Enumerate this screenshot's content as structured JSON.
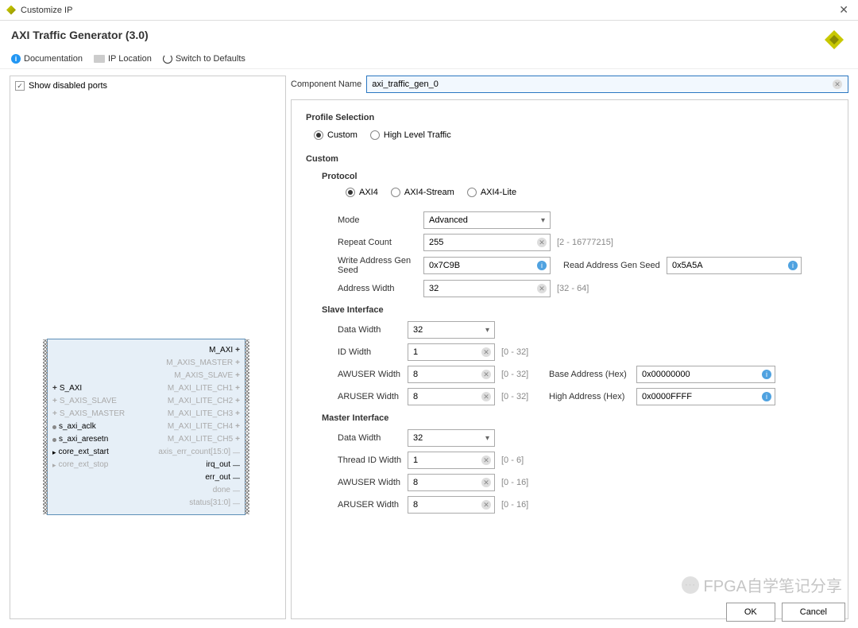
{
  "title_bar": "Customize IP",
  "page_title": "AXI Traffic Generator (3.0)",
  "toolbar": {
    "documentation": "Documentation",
    "ip_location": "IP Location",
    "switch_defaults": "Switch to Defaults"
  },
  "left_panel": {
    "show_disabled_label": "Show disabled ports",
    "ports_right": [
      {
        "name": "M_AXI",
        "enabled": true,
        "plus": true,
        "hatch": true
      },
      {
        "name": "M_AXIS_MASTER",
        "enabled": false,
        "plus": true,
        "hatch": true
      },
      {
        "name": "M_AXIS_SLAVE",
        "enabled": false,
        "plus": true,
        "hatch": true
      },
      {
        "name": "M_AXI_LITE_CH1",
        "enabled": false,
        "plus": true,
        "hatch": true
      },
      {
        "name": "M_AXI_LITE_CH2",
        "enabled": false,
        "plus": true,
        "hatch": true
      },
      {
        "name": "M_AXI_LITE_CH3",
        "enabled": false,
        "plus": true,
        "hatch": true
      },
      {
        "name": "M_AXI_LITE_CH4",
        "enabled": false,
        "plus": true,
        "hatch": true
      },
      {
        "name": "M_AXI_LITE_CH5",
        "enabled": false,
        "plus": true,
        "hatch": true
      },
      {
        "name": "axis_err_count[15:0]",
        "enabled": false,
        "plus": false,
        "hatch": false
      },
      {
        "name": "irq_out",
        "enabled": true,
        "plus": false,
        "hatch": false
      },
      {
        "name": "err_out",
        "enabled": true,
        "plus": false,
        "hatch": false
      },
      {
        "name": "done",
        "enabled": false,
        "plus": false,
        "hatch": false
      },
      {
        "name": "status[31:0]",
        "enabled": false,
        "plus": false,
        "hatch": false
      }
    ],
    "ports_left": [
      {
        "name": "S_AXI",
        "enabled": true,
        "plus": true,
        "hatch": true
      },
      {
        "name": "S_AXIS_SLAVE",
        "enabled": false,
        "plus": true,
        "hatch": true
      },
      {
        "name": "S_AXIS_MASTER",
        "enabled": false,
        "plus": true,
        "hatch": true
      },
      {
        "name": "s_axi_aclk",
        "enabled": true,
        "plus": false,
        "dot": true
      },
      {
        "name": "s_axi_aresetn",
        "enabled": true,
        "plus": false,
        "dot": true
      },
      {
        "name": "core_ext_start",
        "enabled": true,
        "plus": false,
        "arrow": true
      },
      {
        "name": "core_ext_stop",
        "enabled": false,
        "plus": false,
        "arrow": true
      }
    ]
  },
  "component_name_label": "Component Name",
  "component_name_value": "axi_traffic_gen_0",
  "profile": {
    "title": "Profile Selection",
    "options": [
      "Custom",
      "High Level Traffic"
    ],
    "selected": "Custom"
  },
  "custom": {
    "title": "Custom",
    "protocol": {
      "title": "Protocol",
      "options": [
        "AXI4",
        "AXI4-Stream",
        "AXI4-Lite"
      ],
      "selected": "AXI4",
      "mode_label": "Mode",
      "mode_value": "Advanced",
      "repeat_label": "Repeat Count",
      "repeat_value": "255",
      "repeat_hint": "[2 - 16777215]",
      "write_seed_label": "Write Address Gen Seed",
      "write_seed_value": "0x7C9B",
      "read_seed_label": "Read Address Gen Seed",
      "read_seed_value": "0x5A5A",
      "addr_width_label": "Address Width",
      "addr_width_value": "32",
      "addr_width_hint": "[32 - 64]"
    },
    "slave": {
      "title": "Slave Interface",
      "data_width_label": "Data Width",
      "data_width_value": "32",
      "id_width_label": "ID Width",
      "id_width_value": "1",
      "id_width_hint": "[0 - 32]",
      "awuser_label": "AWUSER Width",
      "awuser_value": "8",
      "awuser_hint": "[0 - 32]",
      "base_addr_label": "Base Address (Hex)",
      "base_addr_value": "0x00000000",
      "aruser_label": "ARUSER Width",
      "aruser_value": "8",
      "aruser_hint": "[0 - 32]",
      "high_addr_label": "High Address (Hex)",
      "high_addr_value": "0x0000FFFF"
    },
    "master": {
      "title": "Master Interface",
      "data_width_label": "Data Width",
      "data_width_value": "32",
      "thread_id_label": "Thread ID Width",
      "thread_id_value": "1",
      "thread_id_hint": "[0 - 6]",
      "awuser_label": "AWUSER Width",
      "awuser_value": "8",
      "awuser_hint": "[0 - 16]",
      "aruser_label": "ARUSER Width",
      "aruser_value": "8",
      "aruser_hint": "[0 - 16]"
    }
  },
  "footer": {
    "ok": "OK",
    "cancel": "Cancel"
  },
  "watermark": "FPGA自学笔记分享"
}
